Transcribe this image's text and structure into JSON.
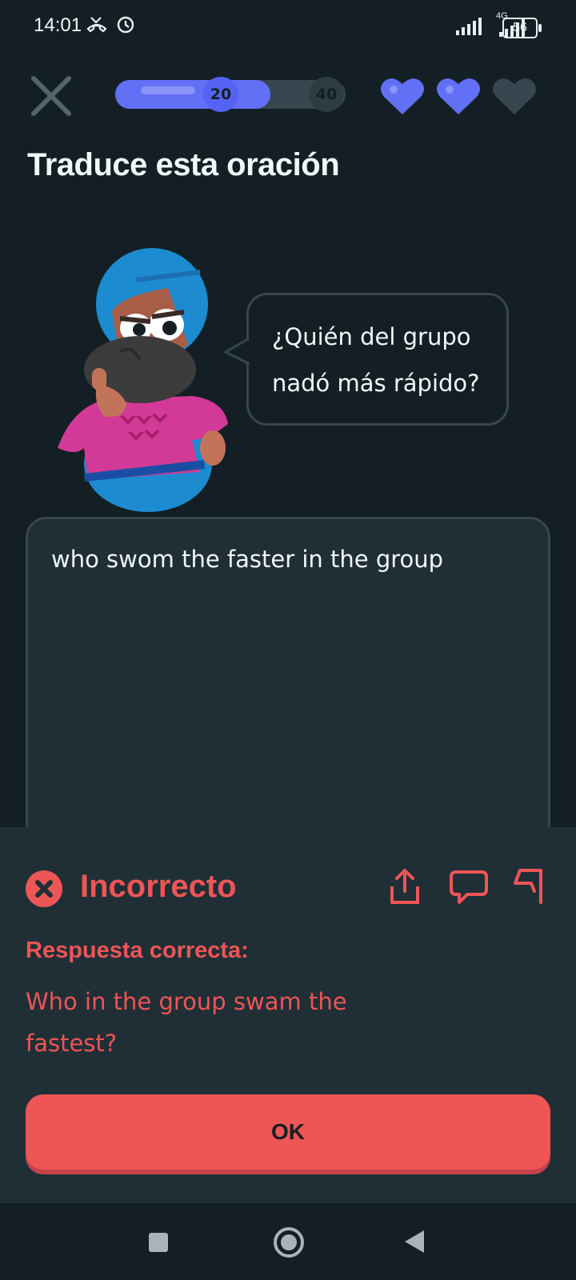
{
  "status_bar": {
    "time": "14:01",
    "network_label": "4G",
    "battery": "56",
    "icons": [
      "missed-call-icon",
      "sync-icon",
      "signal-icon",
      "signal-4g-icon",
      "battery-icon"
    ]
  },
  "header": {
    "progress_current": "20",
    "progress_target": "40",
    "progress_fraction": 0.5,
    "hearts_full": 2,
    "hearts_total": 3,
    "accent_color": "#6270f6"
  },
  "prompt": {
    "title": "Traduce esta oración",
    "sentence_line1": "¿Quién del grupo",
    "sentence_line2": "nadó más rápido?"
  },
  "answer": {
    "text": "who swom the faster in the group"
  },
  "feedback": {
    "status": "Incorrecto",
    "correct_label": "Respuesta correcta:",
    "correct_answer": "Who in the group swam the fastest?",
    "status_color": "#ee5555",
    "actions": [
      "share-icon",
      "comment-icon",
      "flag-icon"
    ]
  },
  "ok_button": {
    "label": "OK"
  }
}
